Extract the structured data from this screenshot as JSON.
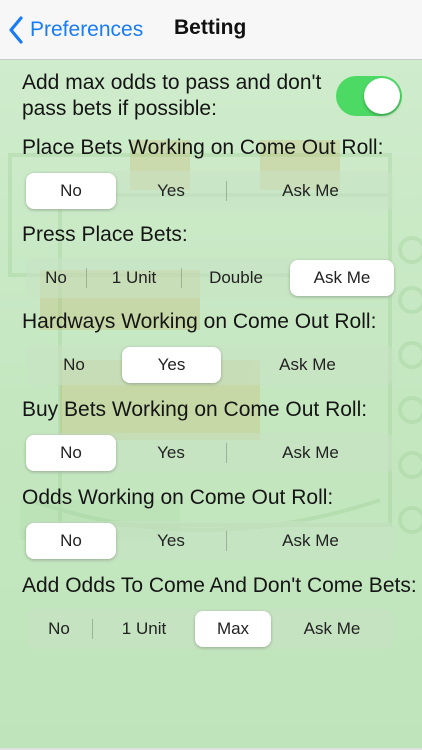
{
  "nav": {
    "back_label": "Preferences",
    "title": "Betting"
  },
  "max_odds": {
    "label": "Add max odds to pass and don't pass bets if possible:",
    "enabled": true
  },
  "place_bets": {
    "label": "Place Bets Working on Come Out Roll:",
    "options": [
      "No",
      "Yes",
      "Ask Me"
    ],
    "selected": "No"
  },
  "press_place": {
    "label": "Press Place Bets:",
    "options": [
      "No",
      "1 Unit",
      "Double",
      "Ask Me"
    ],
    "selected": "Ask Me"
  },
  "hardways": {
    "label": "Hardways Working on Come Out Roll:",
    "options": [
      "No",
      "Yes",
      "Ask Me"
    ],
    "selected": "Yes"
  },
  "buy_bets": {
    "label": "Buy Bets Working on Come Out Roll:",
    "options": [
      "No",
      "Yes",
      "Ask Me"
    ],
    "selected": "No"
  },
  "odds_working": {
    "label": "Odds Working on Come Out Roll:",
    "options": [
      "No",
      "Yes",
      "Ask Me"
    ],
    "selected": "No"
  },
  "come_odds": {
    "label": "Add Odds To Come And Don't Come Bets:",
    "options": [
      "No",
      "1 Unit",
      "Max",
      "Ask Me"
    ],
    "selected": "Max"
  },
  "colors": {
    "accent": "#1a7cf5",
    "toggle_on": "#4cd964",
    "felt": "#c4e7c0"
  }
}
